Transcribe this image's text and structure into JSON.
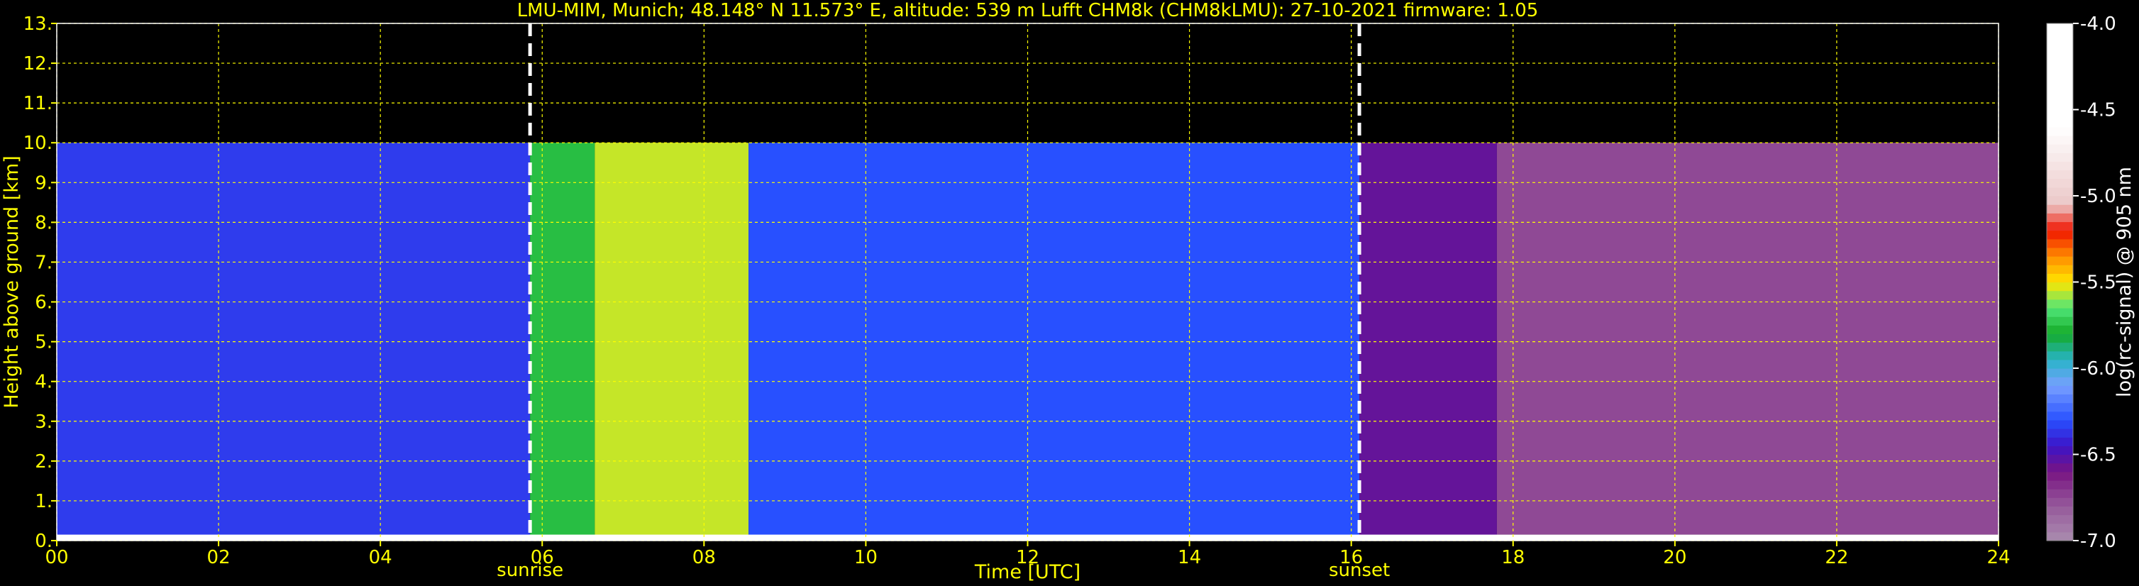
{
  "chart_data": {
    "type": "heatmap",
    "title": "LMU-MIM, Munich; 48.148° N 11.573° E, altitude: 539 m    Lufft CHM8k (CHM8kLMU): 27-10-2021    firmware: 1.05",
    "xlabel": "Time [UTC]",
    "ylabel": "Height above ground [km]",
    "xlim": [
      0,
      24
    ],
    "ylim": [
      0,
      13
    ],
    "x_ticks": [
      {
        "value": 0,
        "label": "00"
      },
      {
        "value": 2,
        "label": "02"
      },
      {
        "value": 4,
        "label": "04"
      },
      {
        "value": 6,
        "label": "06"
      },
      {
        "value": 8,
        "label": "08"
      },
      {
        "value": 10,
        "label": "10"
      },
      {
        "value": 12,
        "label": "12"
      },
      {
        "value": 14,
        "label": "14"
      },
      {
        "value": 16,
        "label": "16"
      },
      {
        "value": 18,
        "label": "18"
      },
      {
        "value": 20,
        "label": "20"
      },
      {
        "value": 22,
        "label": "22"
      },
      {
        "value": 24,
        "label": "24"
      }
    ],
    "y_ticks": [
      {
        "value": 0,
        "label": "0."
      },
      {
        "value": 1,
        "label": "1."
      },
      {
        "value": 2,
        "label": "2."
      },
      {
        "value": 3,
        "label": "3."
      },
      {
        "value": 4,
        "label": "4."
      },
      {
        "value": 5,
        "label": "5."
      },
      {
        "value": 6,
        "label": "6."
      },
      {
        "value": 7,
        "label": "7."
      },
      {
        "value": 8,
        "label": "8."
      },
      {
        "value": 9,
        "label": "9."
      },
      {
        "value": 10,
        "label": "10."
      },
      {
        "value": 11,
        "label": "11."
      },
      {
        "value": 12,
        "label": "12."
      },
      {
        "value": 13,
        "label": "13."
      }
    ],
    "grid": true,
    "grid_color": "#ffff00",
    "event_markers": [
      {
        "x": 5.85,
        "label": "sunrise"
      },
      {
        "x": 16.1,
        "label": "sunset"
      }
    ],
    "colorbar": {
      "label": "log(rc-signal) @ 905 nm",
      "range": [
        -7.0,
        -4.0
      ],
      "ticks": [
        -7.0,
        -6.5,
        -6.0,
        -5.5,
        -5.0,
        -4.5,
        -4.0
      ],
      "tick_labels": [
        "-7.0",
        "-6.5",
        "-6.0",
        "-5.5",
        "-5.0",
        "-4.5",
        "-4.0"
      ],
      "position": "right"
    },
    "signal_ceiling_km": 10.0,
    "regions": [
      {
        "x": [
          0.0,
          5.85
        ],
        "y": [
          0.0,
          10.0
        ],
        "value": -6.35
      },
      {
        "x": [
          5.85,
          6.65
        ],
        "y": [
          0.0,
          10.0
        ],
        "value": -5.75
      },
      {
        "x": [
          6.65,
          8.55
        ],
        "y": [
          0.0,
          10.0
        ],
        "value": -5.55
      },
      {
        "x": [
          8.55,
          16.1
        ],
        "y": [
          0.0,
          10.0
        ],
        "value": -6.3
      },
      {
        "x": [
          16.1,
          17.8
        ],
        "y": [
          0.0,
          10.0
        ],
        "value": -6.55
      },
      {
        "x": [
          17.8,
          24.0
        ],
        "y": [
          0.15,
          10.0
        ],
        "value": -6.75
      },
      {
        "x": [
          0.0,
          24.0
        ],
        "y": [
          0.0,
          0.15
        ],
        "value": -4.0
      }
    ]
  }
}
